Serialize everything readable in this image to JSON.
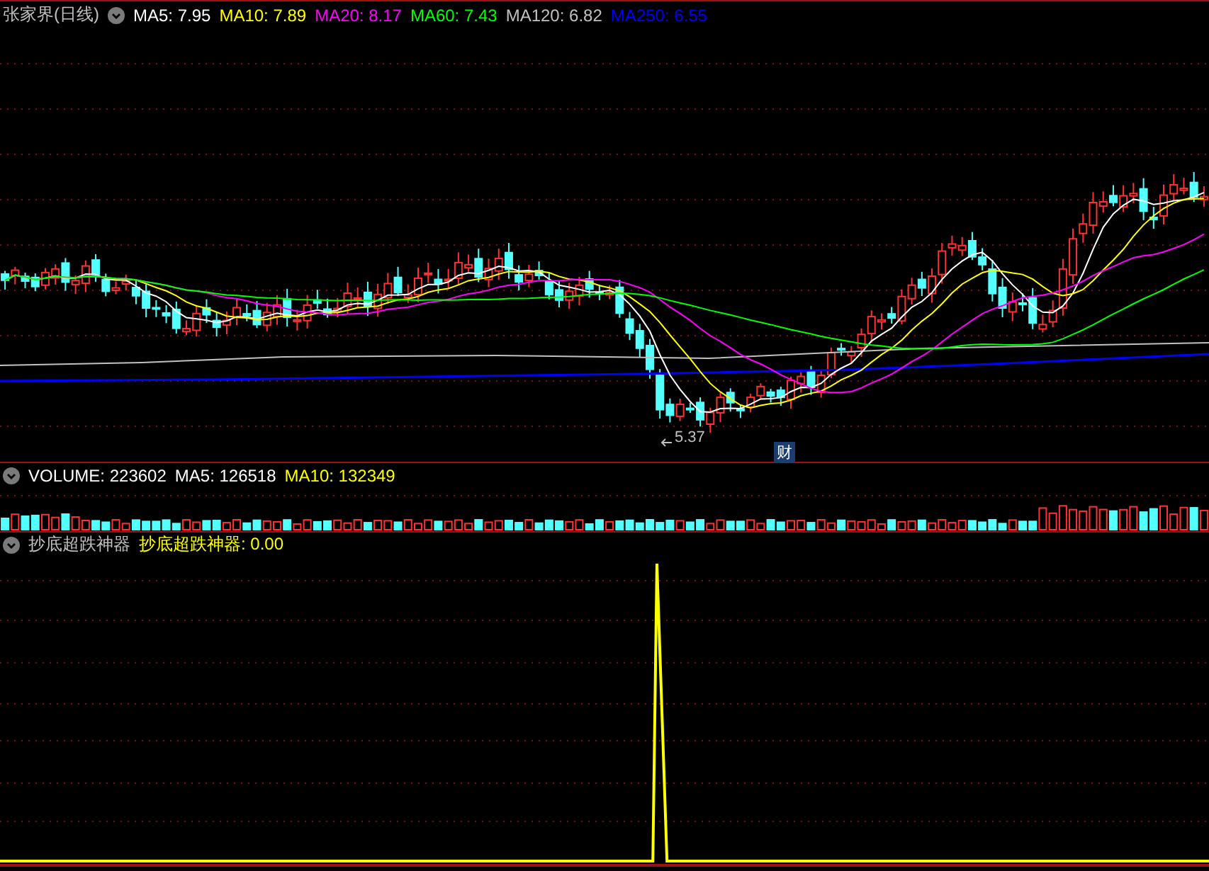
{
  "main_chart": {
    "title": "张家界(日线)",
    "legend": [
      {
        "text": "MA5: 7.95",
        "color": "#ffffff"
      },
      {
        "text": "MA10: 7.89",
        "color": "#ffff00"
      },
      {
        "text": "MA20: 8.17",
        "color": "#ff00ff"
      },
      {
        "text": "MA60: 7.43",
        "color": "#00ff00"
      },
      {
        "text": "MA120: 6.82",
        "color": "#c0c0c0"
      },
      {
        "text": "MA250: 6.55",
        "color": "#0000ff"
      }
    ],
    "low_label": "5.37",
    "marker": "财"
  },
  "volume_panel": {
    "legend": [
      {
        "text": "VOLUME: 223602",
        "color": "#ffffff"
      },
      {
        "text": "MA5: 126518",
        "color": "#ffffff"
      },
      {
        "text": "MA10: 132349",
        "color": "#ffff00"
      }
    ]
  },
  "indicator_panel": {
    "title": "抄底超跌神器",
    "legend": [
      {
        "text": "抄底超跌神器: 0.00",
        "color": "#ffff00"
      }
    ]
  }
}
